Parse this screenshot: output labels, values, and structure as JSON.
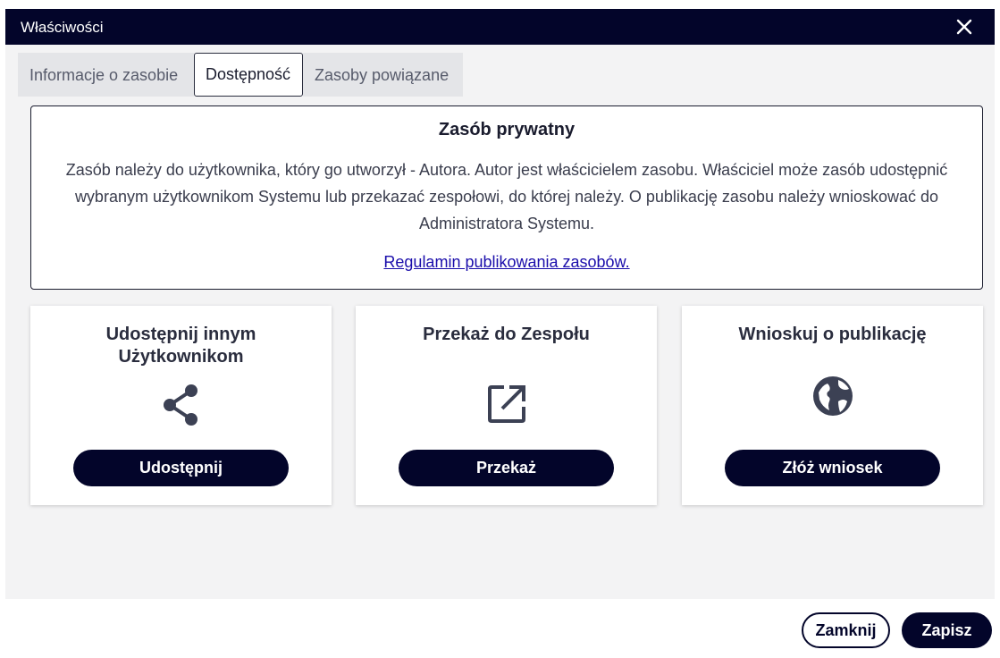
{
  "dialog": {
    "title": "Właściwości",
    "close_icon": "close-icon"
  },
  "tabs": [
    {
      "label": "Informacje o zasobie",
      "active": false
    },
    {
      "label": "Dostępność",
      "active": true
    },
    {
      "label": "Zasoby powiązane",
      "active": false
    }
  ],
  "info": {
    "heading": "Zasób prywatny",
    "body": "Zasób należy do użytkownika, który go utworzył - Autora. Autor jest właścicielem zasobu. Właściciel może zasób udostępnić wybranym użytkownikom Systemu lub przekazać zespołowi, do której należy. O publikację zasobu należy wnioskować do Administratora Systemu.",
    "link": "Regulamin publikowania zasobów."
  },
  "cards": [
    {
      "title": "Udostępnij innym Użytkownikom",
      "icon": "share-icon",
      "button": "Udostępnij"
    },
    {
      "title": "Przekaż do Zespołu",
      "icon": "open-in-new-icon",
      "button": "Przekaż"
    },
    {
      "title": "Wnioskuj o publikację",
      "icon": "globe-icon",
      "button": "Złóż wniosek"
    }
  ],
  "footer": {
    "close_label": "Zamknij",
    "save_label": "Zapisz"
  },
  "colors": {
    "primary": "#03052a",
    "link": "#1a0dab",
    "background": "#f3f3f4"
  }
}
